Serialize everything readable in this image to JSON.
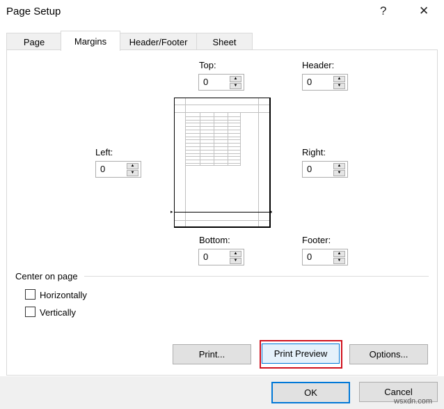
{
  "window": {
    "title": "Page Setup",
    "help": "?",
    "close": "✕"
  },
  "tabs": [
    {
      "label": "Page"
    },
    {
      "label": "Margins"
    },
    {
      "label": "Header/Footer"
    },
    {
      "label": "Sheet"
    }
  ],
  "margins": {
    "top": {
      "label": "Top:",
      "value": "0"
    },
    "header": {
      "label": "Header:",
      "value": "0"
    },
    "left": {
      "label": "Left:",
      "value": "0"
    },
    "right": {
      "label": "Right:",
      "value": "0"
    },
    "bottom": {
      "label": "Bottom:",
      "value": "0"
    },
    "footer": {
      "label": "Footer:",
      "value": "0"
    }
  },
  "center": {
    "title": "Center on page",
    "horizontally": "Horizontally",
    "vertically": "Vertically",
    "horizontally_checked": false,
    "vertically_checked": false
  },
  "buttons": {
    "print": "Print...",
    "print_preview": "Print Preview",
    "options": "Options...",
    "ok": "OK",
    "cancel": "Cancel"
  },
  "watermark": "wsxdn.com",
  "colors": {
    "highlight": "#d0101c",
    "focus": "#0078d7"
  }
}
